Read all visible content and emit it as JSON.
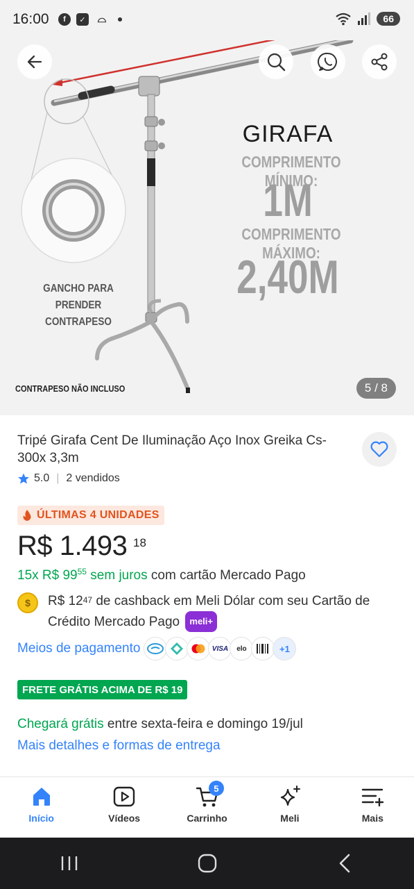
{
  "status_bar": {
    "time": "16:00",
    "battery": "66"
  },
  "hero": {
    "title": "GIRAFA",
    "min_label": "COMPRIMENTO MÍNIMO:",
    "min_value": "1M",
    "max_label": "COMPRIMENTO MÁXIMO:",
    "max_value": "2,40M",
    "hook_label": "GANCHO PARA PRENDER CONTRAPESO",
    "counterweight_label": "CONTRAPESO NÃO INCLUSO",
    "counter": "5 / 8"
  },
  "product": {
    "title": "Tripé Girafa Cent De Iluminação Aço Inox Greika Cs-300x 3,3m",
    "rating": "5.0",
    "sold": "2 vendidos",
    "stock_badge": "ÚLTIMAS 4 UNIDADES",
    "price_main": "R$ 1.493",
    "price_cents": "18",
    "installments_prefix": "15x R$ 99",
    "installments_cents": "55",
    "installments_suffix": "sem juros",
    "installments_tail": "com cartão Mercado Pago",
    "cashback_amount": "R$ 12",
    "cashback_cents": "47",
    "cashback_text": "de cashback em Meli Dólar com seu Cartão de Crédito Mercado Pago",
    "meli_plus": "meli+",
    "payment_link": "Meios de pagamento",
    "payment_more": "+1",
    "free_shipping": "FRETE GRÁTIS ACIMA DE R$ 19",
    "delivery_highlight": "Chegará grátis",
    "delivery_text": "entre sexta-feira e domingo 19/jul",
    "more_details": "Mais detalhes e formas de entrega"
  },
  "bottom_nav": {
    "items": [
      {
        "label": "Início",
        "icon": "home-icon"
      },
      {
        "label": "Vídeos",
        "icon": "video-icon"
      },
      {
        "label": "Carrinho",
        "icon": "cart-icon",
        "badge": "5"
      },
      {
        "label": "Meli",
        "icon": "sparkle-icon"
      },
      {
        "label": "Mais",
        "icon": "menu-icon"
      }
    ]
  },
  "colors": {
    "accent_blue": "#3483fa",
    "green": "#00a650",
    "orange": "#e0541f"
  }
}
